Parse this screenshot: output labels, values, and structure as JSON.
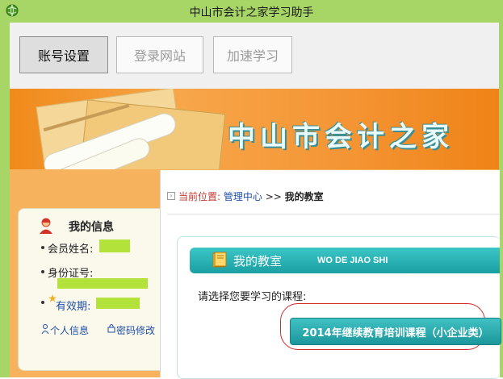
{
  "window": {
    "title": "中山市会计之家学习助手",
    "icon": "globe-icon"
  },
  "toolbar": {
    "buttons": [
      {
        "label": "账号设置",
        "active": true
      },
      {
        "label": "登录网站",
        "active": false
      },
      {
        "label": "加速学习",
        "active": false
      }
    ]
  },
  "banner": {
    "title": "中山市会计之家"
  },
  "info": {
    "title": "我的信息",
    "member_name_label": "会员姓名:",
    "id_label": "身份证号:",
    "validity_label": "有效期:",
    "personal_info_link": "个人信息",
    "password_link": "密码修改"
  },
  "breadcrumb": {
    "prefix": "当前位置:",
    "link": "管理中心",
    "separator": ">>",
    "current": "我的教室"
  },
  "classroom": {
    "title": "我的教室",
    "subtitle": "WO DE JIAO SHI",
    "prompt": "请选择您要学习的课程:",
    "course_button": "2014年继续教育培训课程（小企业类）"
  },
  "colors": {
    "frame": "#a7d666",
    "teal": "#1a9fa3",
    "banner_orange": "#f08a1a",
    "highlight_red": "#d22a2a"
  }
}
